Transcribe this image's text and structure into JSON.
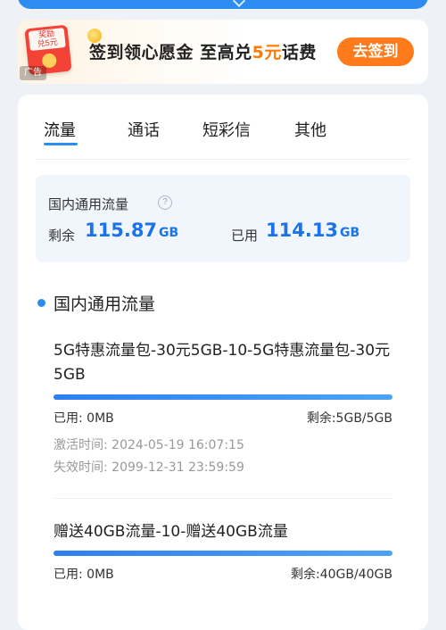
{
  "ad": {
    "coupon_line1": "奖励",
    "coupon_line2": "兑5元",
    "tag": "广告",
    "text_part1": "签到领心愿金 至高兑",
    "text_highlight": "5元",
    "text_part2": "话费",
    "button": "去签到"
  },
  "tabs": [
    "流量",
    "通话",
    "短彩信",
    "其他"
  ],
  "summary": {
    "title": "国内通用流量",
    "info": "?",
    "remain_label": "剩余",
    "remain_value": "115.87",
    "remain_unit": "GB",
    "used_label": "已用",
    "used_value": "114.13",
    "used_unit": "GB"
  },
  "section_title": "国内通用流量",
  "packages": [
    {
      "name": "5G特惠流量包-30元5GB-10-5G特惠流量包-30元5GB",
      "used": "已用: 0MB",
      "remain": "剩余:5GB/5GB",
      "activated": "激活时间: 2024-05-19 16:07:15",
      "expires": "失效时间: 2099-12-31 23:59:59",
      "remaining_fraction": 1.0
    },
    {
      "name": "赠送40GB流量-10-赠送40GB流量",
      "used": "已用: 0MB",
      "remain": "剩余:40GB/40GB",
      "remaining_fraction": 1.0
    }
  ],
  "colors": {
    "accent": "#2d8cf0",
    "value_blue": "#1a73e8",
    "ad_orange": "#ff7a1a"
  }
}
